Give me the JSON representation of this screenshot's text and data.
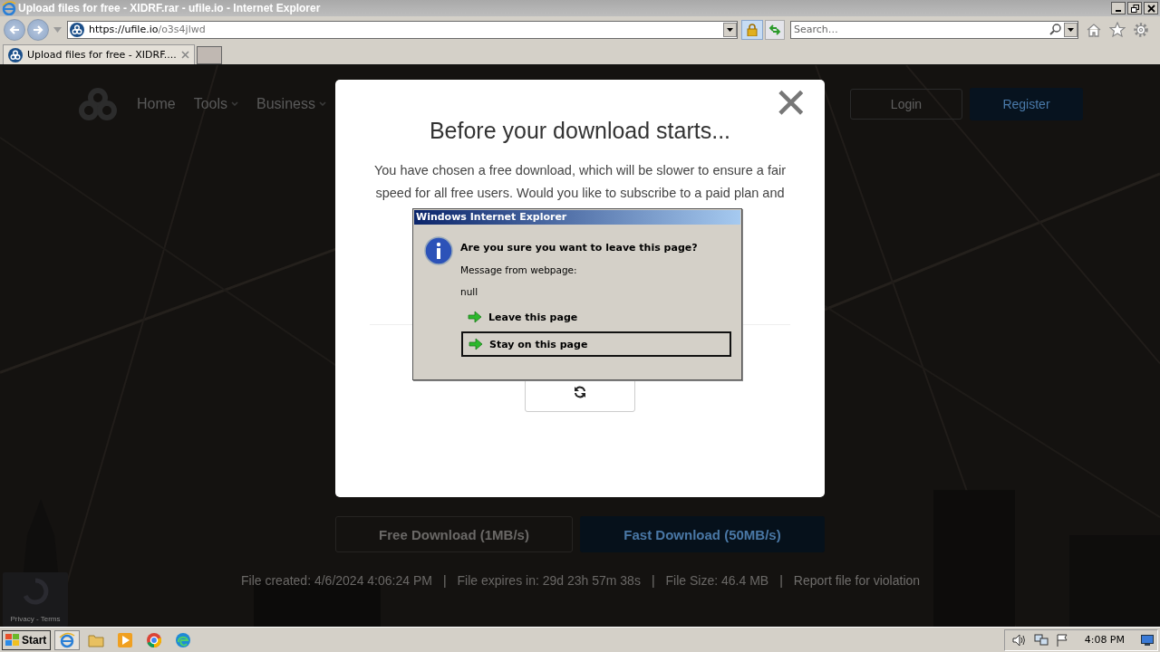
{
  "window": {
    "title": "Upload files for free - XIDRF.rar - ufile.io - Internet Explorer"
  },
  "address_bar": {
    "host": "https://ufile.io",
    "path": "/o3s4jlwd"
  },
  "search": {
    "placeholder": "Search…"
  },
  "tabs": [
    {
      "label": "Upload files for free - XIDRF....",
      "selected": true
    }
  ],
  "site_nav": {
    "items": [
      {
        "label": "Home",
        "dropdown": false
      },
      {
        "label": "Tools",
        "dropdown": true
      },
      {
        "label": "Business",
        "dropdown": true
      }
    ],
    "login": "Login",
    "register": "Register"
  },
  "download_buttons": [
    {
      "label": "Free Download (1MB/s)",
      "kind": "outline"
    },
    {
      "label": "Fast Download (50MB/s)",
      "kind": "primary"
    }
  ],
  "file_info": [
    {
      "text": "File created: 4/6/2024 4:06:24 PM",
      "kind": "text"
    },
    {
      "text": "|",
      "kind": "separator"
    },
    {
      "text": "File expires in: 29d 23h 57m 38s",
      "kind": "text"
    },
    {
      "text": "|",
      "kind": "separator"
    },
    {
      "text": "File Size: 46.4 MB",
      "kind": "text"
    },
    {
      "text": "|",
      "kind": "separator"
    },
    {
      "text": "Report file for violation",
      "kind": "link"
    }
  ],
  "recaptcha": {
    "label": "Privacy - Terms"
  },
  "modal": {
    "close": "✕",
    "title": "Before your download starts...",
    "lines": [
      "You have chosen a free download, which will be slower to ensure a fair",
      "speed for all free users. Would you like to subscribe to a paid plan and"
    ]
  },
  "alert": {
    "title": "Windows Internet Explorer",
    "heading": "Are you sure you want to leave this page?",
    "message_label": "Message from webpage:",
    "message": "null",
    "options": [
      {
        "label": "Leave this page",
        "selected": false
      },
      {
        "label": "Stay on this page",
        "selected": true
      }
    ]
  },
  "taskbar": {
    "start": "Start",
    "clock": "4:08 PM"
  }
}
